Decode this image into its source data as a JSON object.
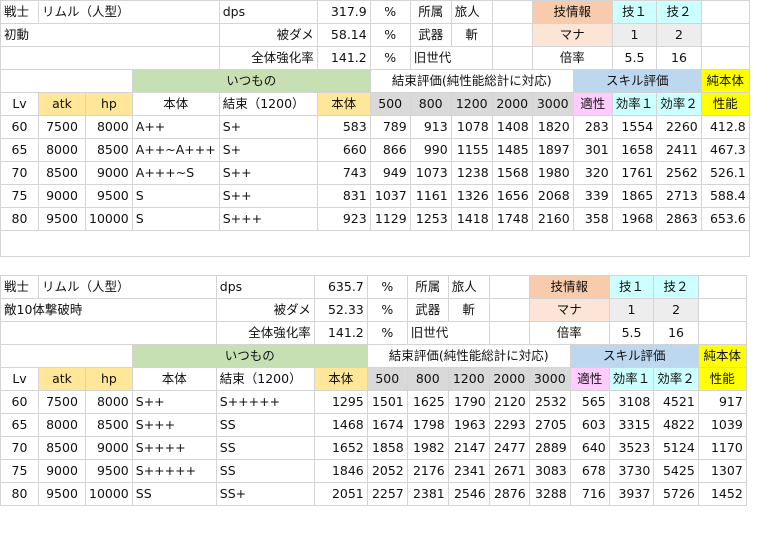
{
  "colors": {
    "green": "#c6e0b4",
    "orange": "#f8cbad",
    "cyan": "#ccffff",
    "blue": "#bdd7ee",
    "yellow": "#ffff00",
    "pink": "#ffccff",
    "gold": "#ffe699",
    "gray": "#d9d9d9"
  },
  "sections": [
    {
      "class_label": "戦士",
      "char_name": "リムル（人型）",
      "condition": "初動",
      "dps_label": "dps",
      "dps_value": "317.9",
      "dps_unit": "%",
      "damage_label": "被ダメ",
      "damage_value": "58.14",
      "damage_unit": "%",
      "boost_label": "全体強化率",
      "boost_value": "141.2",
      "boost_unit": "%",
      "affil_label": "所属",
      "affil_value": "旅人",
      "weapon_label": "武器",
      "weapon_value": "斬",
      "gen_value": "旧世代",
      "skill_info_label": "技情報",
      "skill1_label": "技１",
      "skill2_label": "技２",
      "mana_label": "マナ",
      "mana1": "1",
      "mana2": "2",
      "mult_label": "倍率",
      "mult1": "5.5",
      "mult2": "16",
      "usual_label": "いつもの",
      "bond_eval_label": "結束評価(純性能総計に対応)",
      "skill_eval_label": "スキル評価",
      "pure_label_1": "純本体",
      "pure_label_2": "性能",
      "headers": [
        "Lv",
        "atk",
        "hp",
        "本体",
        "結束（1200）",
        "本体",
        "500",
        "800",
        "1200",
        "2000",
        "3000",
        "適性",
        "効率１",
        "効率２"
      ],
      "rows": [
        [
          "60",
          "7500",
          "8000",
          "A++",
          "S+",
          "583",
          "789",
          "913",
          "1078",
          "1408",
          "1820",
          "283",
          "1554",
          "2260",
          "412.8"
        ],
        [
          "65",
          "8000",
          "8500",
          "A++~A+++",
          "S+",
          "660",
          "866",
          "990",
          "1155",
          "1485",
          "1897",
          "301",
          "1658",
          "2411",
          "467.3"
        ],
        [
          "70",
          "8500",
          "9000",
          "A+++~S",
          "S++",
          "743",
          "949",
          "1073",
          "1238",
          "1568",
          "1980",
          "320",
          "1761",
          "2562",
          "526.1"
        ],
        [
          "75",
          "9000",
          "9500",
          "S",
          "S++",
          "831",
          "1037",
          "1161",
          "1326",
          "1656",
          "2068",
          "339",
          "1865",
          "2713",
          "588.4"
        ],
        [
          "80",
          "9500",
          "10000",
          "S",
          "S+++",
          "923",
          "1129",
          "1253",
          "1418",
          "1748",
          "2160",
          "358",
          "1968",
          "2863",
          "653.6"
        ]
      ]
    },
    {
      "class_label": "戦士",
      "char_name": "リムル（人型）",
      "condition": "敵10体撃破時",
      "dps_label": "dps",
      "dps_value": "635.7",
      "dps_unit": "%",
      "damage_label": "被ダメ",
      "damage_value": "52.33",
      "damage_unit": "%",
      "boost_label": "全体強化率",
      "boost_value": "141.2",
      "boost_unit": "%",
      "affil_label": "所属",
      "affil_value": "旅人",
      "weapon_label": "武器",
      "weapon_value": "斬",
      "gen_value": "旧世代",
      "skill_info_label": "技情報",
      "skill1_label": "技１",
      "skill2_label": "技２",
      "mana_label": "マナ",
      "mana1": "1",
      "mana2": "2",
      "mult_label": "倍率",
      "mult1": "5.5",
      "mult2": "16",
      "usual_label": "いつもの",
      "bond_eval_label": "結束評価(純性能総計に対応)",
      "skill_eval_label": "スキル評価",
      "pure_label_1": "純本体",
      "pure_label_2": "性能",
      "headers": [
        "Lv",
        "atk",
        "hp",
        "本体",
        "結束（1200）",
        "本体",
        "500",
        "800",
        "1200",
        "2000",
        "3000",
        "適性",
        "効率１",
        "効率２"
      ],
      "rows": [
        [
          "60",
          "7500",
          "8000",
          "S++",
          "S+++++",
          "1295",
          "1501",
          "1625",
          "1790",
          "2120",
          "2532",
          "565",
          "3108",
          "4521",
          "917"
        ],
        [
          "65",
          "8000",
          "8500",
          "S+++",
          "SS",
          "1468",
          "1674",
          "1798",
          "1963",
          "2293",
          "2705",
          "603",
          "3315",
          "4822",
          "1039"
        ],
        [
          "70",
          "8500",
          "9000",
          "S++++",
          "SS",
          "1652",
          "1858",
          "1982",
          "2147",
          "2477",
          "2889",
          "640",
          "3523",
          "5124",
          "1170"
        ],
        [
          "75",
          "9000",
          "9500",
          "S+++++",
          "SS",
          "1846",
          "2052",
          "2176",
          "2341",
          "2671",
          "3083",
          "678",
          "3730",
          "5425",
          "1307"
        ],
        [
          "80",
          "9500",
          "10000",
          "SS",
          "SS+",
          "2051",
          "2257",
          "2381",
          "2546",
          "2876",
          "3288",
          "716",
          "3937",
          "5726",
          "1452"
        ]
      ]
    }
  ]
}
